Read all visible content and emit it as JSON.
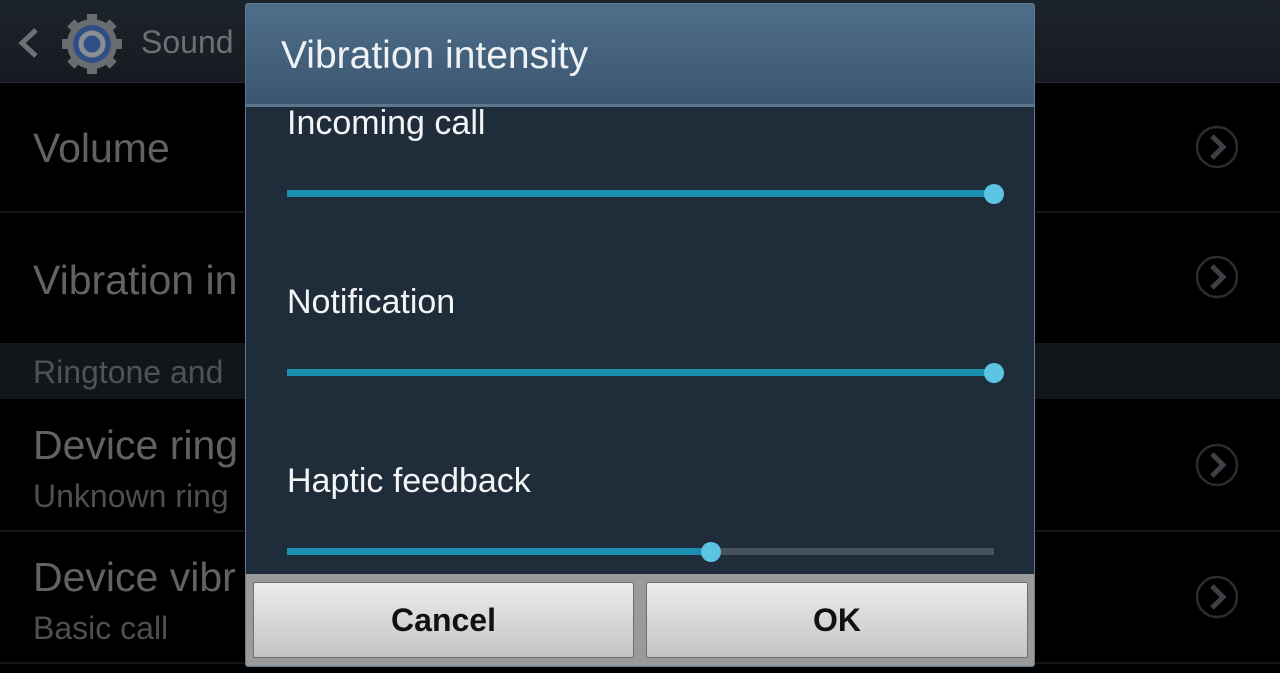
{
  "actionbar": {
    "title": "Sound",
    "back_icon": "chevron-left-icon",
    "app_icon": "gear-icon"
  },
  "background_list": {
    "rows": [
      {
        "title": "Volume",
        "subtitle": null,
        "trailing_icon": "chevron-right-circle-icon"
      },
      {
        "title": "Vibration in",
        "subtitle": null,
        "trailing_icon": "chevron-right-circle-icon"
      }
    ],
    "section_header": "Ringtone and",
    "rows_after_section": [
      {
        "title": "Device ring",
        "subtitle": "Unknown ring",
        "trailing_icon": "chevron-right-circle-icon"
      },
      {
        "title": "Device vibr",
        "subtitle": "Basic call",
        "trailing_icon": "chevron-right-circle-icon"
      }
    ]
  },
  "dialog": {
    "title": "Vibration intensity",
    "sliders": [
      {
        "label": "Incoming call",
        "value_percent": 100
      },
      {
        "label": "Notification",
        "value_percent": 100
      },
      {
        "label": "Haptic feedback",
        "value_percent": 60
      }
    ],
    "buttons": {
      "cancel": "Cancel",
      "ok": "OK"
    }
  },
  "colors": {
    "slider_fill": "#1a8fb0",
    "slider_thumb": "#5cc3e3",
    "slider_track": "#465259",
    "dialog_header": "#4f6e8a",
    "dialog_body": "#1f2d3b"
  }
}
